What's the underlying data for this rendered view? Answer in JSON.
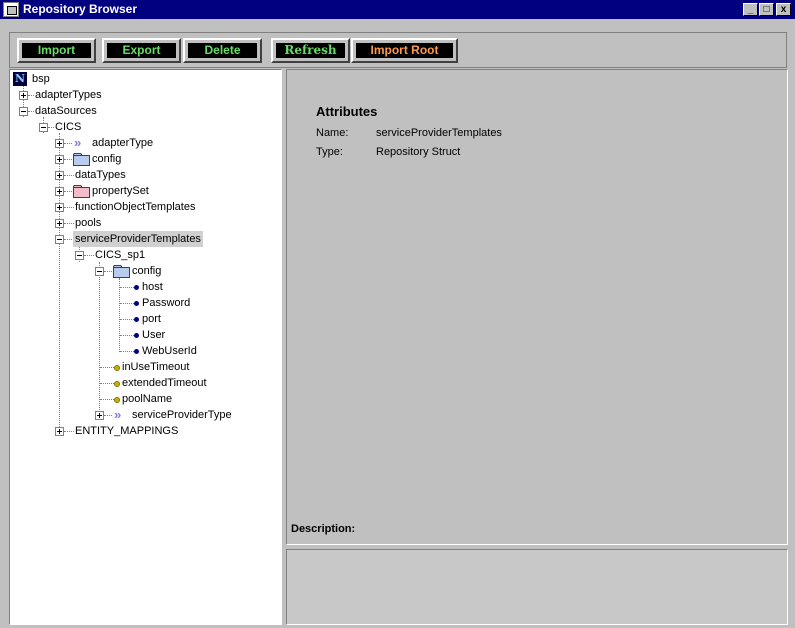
{
  "window": {
    "title": "Repository Browser",
    "controls": {
      "minimize": "_",
      "maximize": "□",
      "close": "x"
    }
  },
  "toolbar": {
    "import_label": "Import",
    "export_label": "Export",
    "delete_label": "Delete",
    "refresh_label": "Refresh",
    "import_root_label": "Import Root",
    "accent_green": "#66dd66",
    "accent_orange": "#ff9a4a"
  },
  "tree": {
    "root": "bsp",
    "nodes": [
      "adapterTypes",
      "dataSources",
      "CICS",
      "adapterType",
      "config",
      "dataTypes",
      "propertySet",
      "functionObjectTemplates",
      "pools",
      "serviceProviderTemplates",
      "CICS_sp1",
      "config",
      "host",
      "Password",
      "port",
      "User",
      "WebUserId",
      "inUseTimeout",
      "extendedTimeout",
      "poolName",
      "serviceProviderType",
      "ENTITY_MAPPINGS"
    ],
    "selected": "serviceProviderTemplates"
  },
  "attributes": {
    "heading": "Attributes",
    "name_label": "Name:",
    "name_value": "serviceProviderTemplates",
    "type_label": "Type:",
    "type_value": "Repository Struct",
    "description_label": "Description:"
  }
}
